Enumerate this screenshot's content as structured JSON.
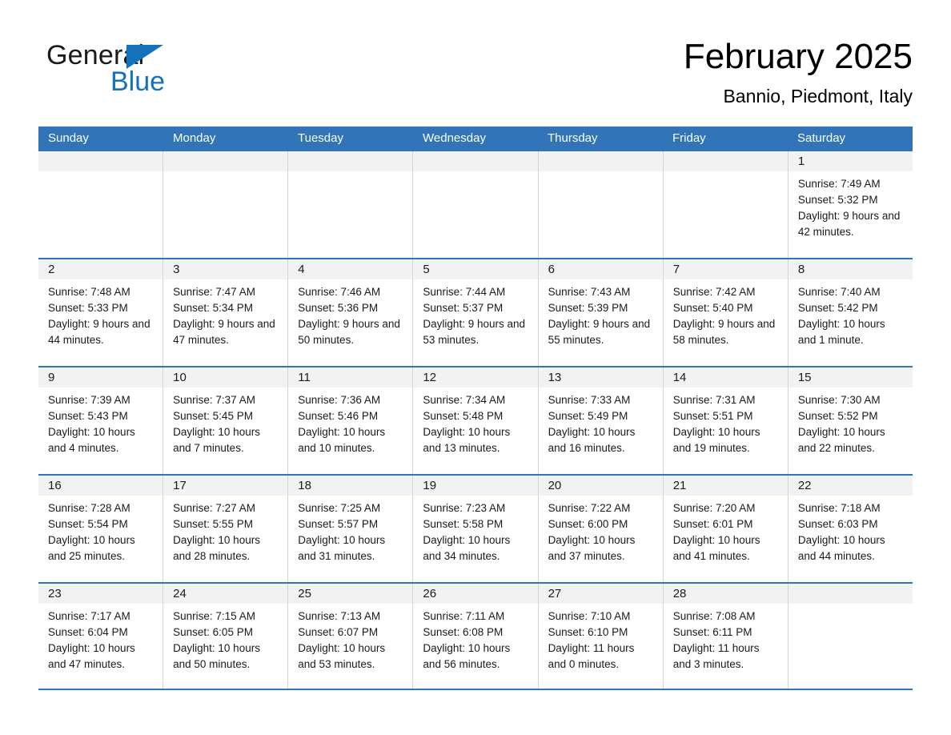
{
  "brand": {
    "name_part1": "General",
    "name_part2": "Blue",
    "triangle_color": "#1272bb",
    "blue_text_color": "#1272bb"
  },
  "header": {
    "title": "February 2025",
    "subtitle": "Bannio, Piedmont, Italy"
  },
  "theme": {
    "header_blue": "#3175b8",
    "day_band_gray": "#f2f2f2",
    "cell_border": "#d4d4d4"
  },
  "weekdays": [
    "Sunday",
    "Monday",
    "Tuesday",
    "Wednesday",
    "Thursday",
    "Friday",
    "Saturday"
  ],
  "weeks": [
    [
      {
        "day": "",
        "sunrise": "",
        "sunset": "",
        "daylight": ""
      },
      {
        "day": "",
        "sunrise": "",
        "sunset": "",
        "daylight": ""
      },
      {
        "day": "",
        "sunrise": "",
        "sunset": "",
        "daylight": ""
      },
      {
        "day": "",
        "sunrise": "",
        "sunset": "",
        "daylight": ""
      },
      {
        "day": "",
        "sunrise": "",
        "sunset": "",
        "daylight": ""
      },
      {
        "day": "",
        "sunrise": "",
        "sunset": "",
        "daylight": ""
      },
      {
        "day": "1",
        "sunrise": "Sunrise: 7:49 AM",
        "sunset": "Sunset: 5:32 PM",
        "daylight": "Daylight: 9 hours and 42 minutes."
      }
    ],
    [
      {
        "day": "2",
        "sunrise": "Sunrise: 7:48 AM",
        "sunset": "Sunset: 5:33 PM",
        "daylight": "Daylight: 9 hours and 44 minutes."
      },
      {
        "day": "3",
        "sunrise": "Sunrise: 7:47 AM",
        "sunset": "Sunset: 5:34 PM",
        "daylight": "Daylight: 9 hours and 47 minutes."
      },
      {
        "day": "4",
        "sunrise": "Sunrise: 7:46 AM",
        "sunset": "Sunset: 5:36 PM",
        "daylight": "Daylight: 9 hours and 50 minutes."
      },
      {
        "day": "5",
        "sunrise": "Sunrise: 7:44 AM",
        "sunset": "Sunset: 5:37 PM",
        "daylight": "Daylight: 9 hours and 53 minutes."
      },
      {
        "day": "6",
        "sunrise": "Sunrise: 7:43 AM",
        "sunset": "Sunset: 5:39 PM",
        "daylight": "Daylight: 9 hours and 55 minutes."
      },
      {
        "day": "7",
        "sunrise": "Sunrise: 7:42 AM",
        "sunset": "Sunset: 5:40 PM",
        "daylight": "Daylight: 9 hours and 58 minutes."
      },
      {
        "day": "8",
        "sunrise": "Sunrise: 7:40 AM",
        "sunset": "Sunset: 5:42 PM",
        "daylight": "Daylight: 10 hours and 1 minute."
      }
    ],
    [
      {
        "day": "9",
        "sunrise": "Sunrise: 7:39 AM",
        "sunset": "Sunset: 5:43 PM",
        "daylight": "Daylight: 10 hours and 4 minutes."
      },
      {
        "day": "10",
        "sunrise": "Sunrise: 7:37 AM",
        "sunset": "Sunset: 5:45 PM",
        "daylight": "Daylight: 10 hours and 7 minutes."
      },
      {
        "day": "11",
        "sunrise": "Sunrise: 7:36 AM",
        "sunset": "Sunset: 5:46 PM",
        "daylight": "Daylight: 10 hours and 10 minutes."
      },
      {
        "day": "12",
        "sunrise": "Sunrise: 7:34 AM",
        "sunset": "Sunset: 5:48 PM",
        "daylight": "Daylight: 10 hours and 13 minutes."
      },
      {
        "day": "13",
        "sunrise": "Sunrise: 7:33 AM",
        "sunset": "Sunset: 5:49 PM",
        "daylight": "Daylight: 10 hours and 16 minutes."
      },
      {
        "day": "14",
        "sunrise": "Sunrise: 7:31 AM",
        "sunset": "Sunset: 5:51 PM",
        "daylight": "Daylight: 10 hours and 19 minutes."
      },
      {
        "day": "15",
        "sunrise": "Sunrise: 7:30 AM",
        "sunset": "Sunset: 5:52 PM",
        "daylight": "Daylight: 10 hours and 22 minutes."
      }
    ],
    [
      {
        "day": "16",
        "sunrise": "Sunrise: 7:28 AM",
        "sunset": "Sunset: 5:54 PM",
        "daylight": "Daylight: 10 hours and 25 minutes."
      },
      {
        "day": "17",
        "sunrise": "Sunrise: 7:27 AM",
        "sunset": "Sunset: 5:55 PM",
        "daylight": "Daylight: 10 hours and 28 minutes."
      },
      {
        "day": "18",
        "sunrise": "Sunrise: 7:25 AM",
        "sunset": "Sunset: 5:57 PM",
        "daylight": "Daylight: 10 hours and 31 minutes."
      },
      {
        "day": "19",
        "sunrise": "Sunrise: 7:23 AM",
        "sunset": "Sunset: 5:58 PM",
        "daylight": "Daylight: 10 hours and 34 minutes."
      },
      {
        "day": "20",
        "sunrise": "Sunrise: 7:22 AM",
        "sunset": "Sunset: 6:00 PM",
        "daylight": "Daylight: 10 hours and 37 minutes."
      },
      {
        "day": "21",
        "sunrise": "Sunrise: 7:20 AM",
        "sunset": "Sunset: 6:01 PM",
        "daylight": "Daylight: 10 hours and 41 minutes."
      },
      {
        "day": "22",
        "sunrise": "Sunrise: 7:18 AM",
        "sunset": "Sunset: 6:03 PM",
        "daylight": "Daylight: 10 hours and 44 minutes."
      }
    ],
    [
      {
        "day": "23",
        "sunrise": "Sunrise: 7:17 AM",
        "sunset": "Sunset: 6:04 PM",
        "daylight": "Daylight: 10 hours and 47 minutes."
      },
      {
        "day": "24",
        "sunrise": "Sunrise: 7:15 AM",
        "sunset": "Sunset: 6:05 PM",
        "daylight": "Daylight: 10 hours and 50 minutes."
      },
      {
        "day": "25",
        "sunrise": "Sunrise: 7:13 AM",
        "sunset": "Sunset: 6:07 PM",
        "daylight": "Daylight: 10 hours and 53 minutes."
      },
      {
        "day": "26",
        "sunrise": "Sunrise: 7:11 AM",
        "sunset": "Sunset: 6:08 PM",
        "daylight": "Daylight: 10 hours and 56 minutes."
      },
      {
        "day": "27",
        "sunrise": "Sunrise: 7:10 AM",
        "sunset": "Sunset: 6:10 PM",
        "daylight": "Daylight: 11 hours and 0 minutes."
      },
      {
        "day": "28",
        "sunrise": "Sunrise: 7:08 AM",
        "sunset": "Sunset: 6:11 PM",
        "daylight": "Daylight: 11 hours and 3 minutes."
      },
      {
        "day": "",
        "sunrise": "",
        "sunset": "",
        "daylight": ""
      }
    ]
  ]
}
